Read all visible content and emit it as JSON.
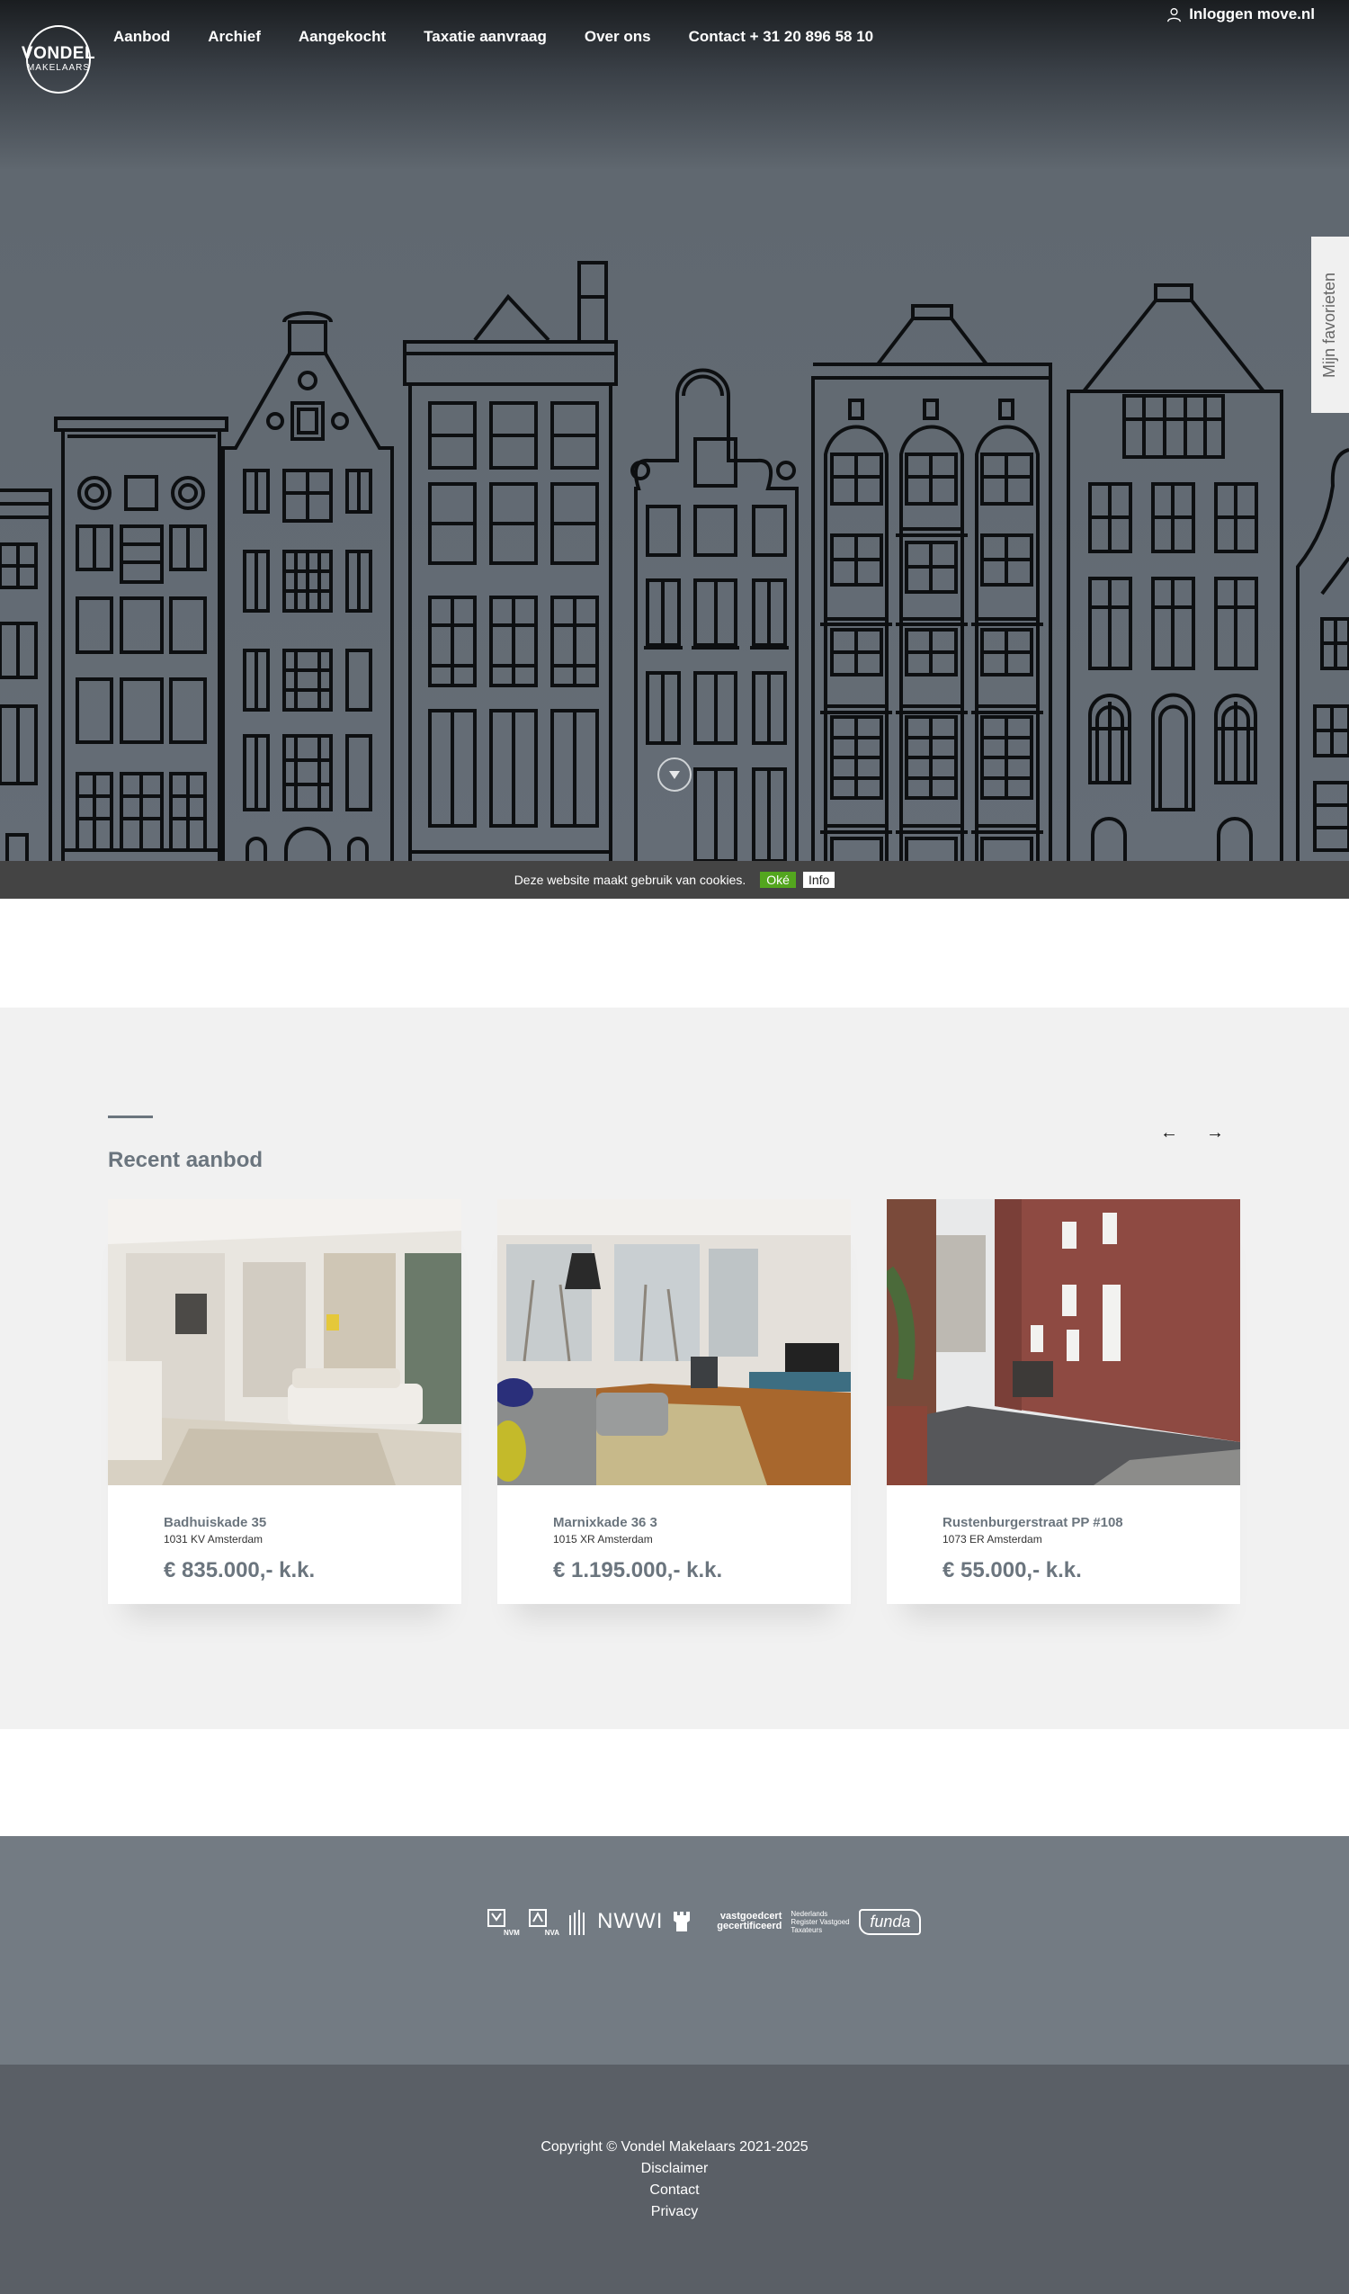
{
  "brand": {
    "line1": "VONDEL",
    "line2": "MAKELAARS"
  },
  "nav": [
    "Aanbod",
    "Archief",
    "Aangekocht",
    "Taxatie aanvraag",
    "Over ons",
    "Contact + 31 20 896 58 10"
  ],
  "login": {
    "label": "Inloggen move.nl",
    "icon": "user-icon"
  },
  "favorites_tab": "Mijn favorieten",
  "cookie": {
    "text": "Deze website maakt gebruik van cookies.",
    "ok": "Oké",
    "info": "Info"
  },
  "recent": {
    "title": "Recent aanbod",
    "prev_icon": "arrow-left-icon",
    "next_icon": "arrow-right-icon",
    "cards": [
      {
        "street": "Badhuiskade 35",
        "city": "1031 KV Amsterdam",
        "price": "€ 835.000,- k.k."
      },
      {
        "street": "Marnixkade 36 3",
        "city": "1015 XR Amsterdam",
        "price": "€ 1.195.000,- k.k."
      },
      {
        "street": "Rustenburgerstraat PP #108",
        "city": "1073 ER Amsterdam",
        "price": "€ 55.000,- k.k."
      }
    ]
  },
  "partners": {
    "nwwi": "NWWI",
    "vastgoed": "vastgoedcert gecertificeerd",
    "register": "Nederlands Register Vastgoed Taxateurs",
    "funda": "funda",
    "nvm": "NVM",
    "nva": "NVA"
  },
  "footer": {
    "copyright": "Copyright © Vondel Makelaars 2021-2025",
    "links": [
      "Disclaimer",
      "Contact",
      "Privacy"
    ]
  },
  "colors": {
    "hero": "#656d76",
    "cookie_bar": "#444444",
    "ok_green": "#53a61e",
    "section_bg": "#f1f1f1",
    "partners_bg": "#737b83",
    "footer_bg": "#5a5f66"
  }
}
